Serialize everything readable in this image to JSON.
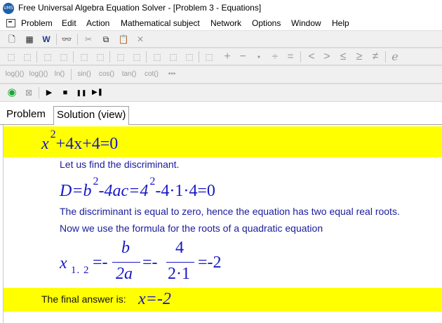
{
  "window": {
    "title": "Free Universal Algebra Equation Solver - [Problem 3 - Equations]",
    "icon_text": "UMS"
  },
  "menu": [
    "Problem",
    "Edit",
    "Action",
    "Mathematical subject",
    "Network",
    "Options",
    "Window",
    "Help"
  ],
  "toolbar1": [
    "🗋",
    "▦",
    "W",
    "👓",
    "✂",
    "⧉",
    "📋",
    "✕"
  ],
  "toolbar2": [
    "⬚",
    "⬚",
    "⬚",
    "⬚",
    "⬚",
    "⬚",
    "⬚",
    "⬚",
    "⬚",
    "⬚",
    "⬚",
    "⬚",
    "⬚",
    "+",
    "−",
    "•",
    "÷",
    "=",
    "<",
    ">",
    "≤",
    "≥",
    "≠",
    "e"
  ],
  "toolbar3": [
    "log()()",
    "log()()",
    "ln()",
    "sin()",
    "cos()",
    "tan()",
    "cot()",
    "•••"
  ],
  "toolbar4": [
    "◉",
    "⊠",
    "▶",
    "■",
    "❚❚",
    "▶❚"
  ],
  "tabs": {
    "problem": "Problem",
    "solution": "Solution (view)"
  },
  "solution": {
    "equation": {
      "x": "x",
      "exp": "2",
      "rest": "+4x+4=0"
    },
    "step1_text": "Let us find the discriminant.",
    "discriminant": {
      "lhs": "D=b",
      "exp1": "2",
      "mid": "-4ac=4",
      "exp2": "2",
      "rhs": "-4·1·4=0"
    },
    "step2_text": "The discriminant is equal to zero, hence the equation has two equal real roots.",
    "step3_text": "Now we use  the formula for the roots of a quadratic equation",
    "roots": {
      "x": "x",
      "sub": "1. 2",
      "eq1": "=-",
      "num1": "b",
      "den1": "2a",
      "eq2": "=-",
      "num2": "4",
      "den2": "2·1",
      "result": "=-2"
    },
    "final_label": "The final answer is:",
    "final_answer": "x=-2"
  },
  "colors": {
    "highlight": "#ffff00",
    "math": "#1717c7",
    "text": "#1b1b9e"
  }
}
